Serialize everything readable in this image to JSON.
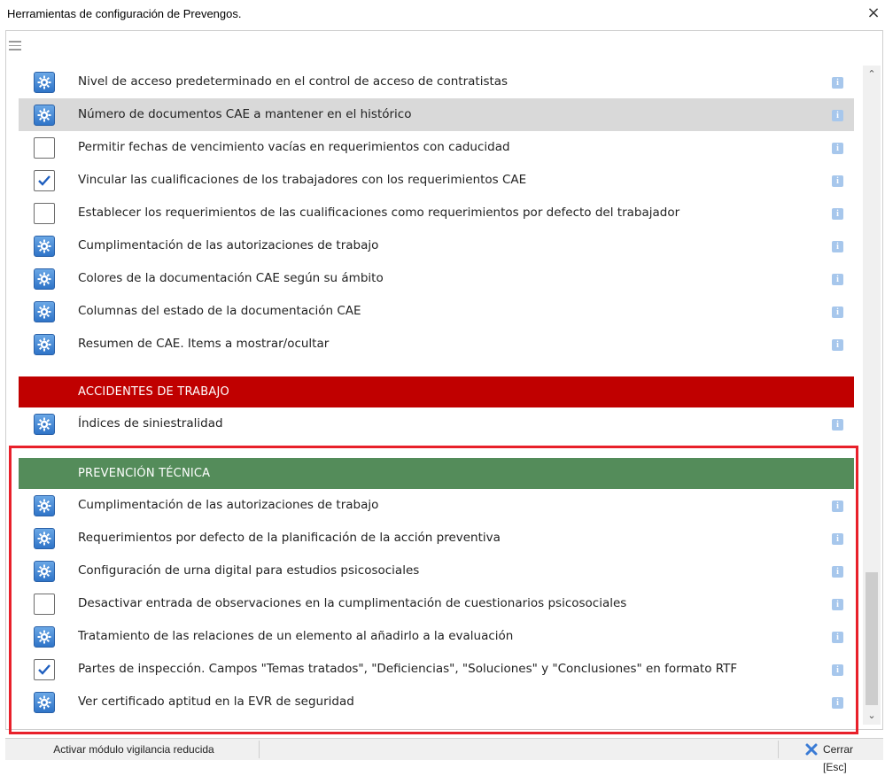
{
  "window": {
    "title": "Herramientas de configuración de Prevengos.",
    "close_glyph": "×"
  },
  "rows_top": [
    {
      "kind": "gear",
      "label": "Nivel de acceso predeterminado en el control de acceso de contratistas",
      "highlight": false
    },
    {
      "kind": "gear",
      "label": "Número de documentos CAE a mantener en el histórico",
      "highlight": true
    },
    {
      "kind": "checkbox",
      "checked": false,
      "label": "Permitir fechas de vencimiento vacías en requerimientos con caducidad",
      "highlight": false
    },
    {
      "kind": "checkbox",
      "checked": true,
      "label": "Vincular las cualificaciones de los trabajadores con los requerimientos CAE",
      "highlight": false
    },
    {
      "kind": "checkbox",
      "checked": false,
      "label": "Establecer los requerimientos de las cualificaciones como requerimientos por defecto del trabajador",
      "highlight": false
    },
    {
      "kind": "gear",
      "label": "Cumplimentación de las autorizaciones de trabajo",
      "highlight": false
    },
    {
      "kind": "gear",
      "label": "Colores de la documentación CAE según su ámbito",
      "highlight": false
    },
    {
      "kind": "gear",
      "label": "Columnas del estado de la documentación CAE",
      "highlight": false
    },
    {
      "kind": "gear",
      "label": "Resumen de CAE. Items a mostrar/ocultar",
      "highlight": false
    }
  ],
  "section_accidentes": {
    "title": "ACCIDENTES DE TRABAJO",
    "color": "#c00000",
    "rows": [
      {
        "kind": "gear",
        "label": "Índices de siniestralidad"
      }
    ]
  },
  "section_prevencion": {
    "title": "PREVENCIÓN TÉCNICA",
    "color": "#548c5a",
    "rows": [
      {
        "kind": "gear",
        "label": "Cumplimentación de las autorizaciones de trabajo"
      },
      {
        "kind": "gear",
        "label": "Requerimientos por defecto de la planificación de la acción preventiva"
      },
      {
        "kind": "gear",
        "label": "Configuración de urna digital para estudios psicosociales"
      },
      {
        "kind": "checkbox",
        "checked": false,
        "label": "Desactivar entrada de observaciones en la cumplimentación de cuestionarios psicosociales"
      },
      {
        "kind": "gear",
        "label": "Tratamiento de las relaciones de un elemento al añadirlo a la evaluación"
      },
      {
        "kind": "checkbox",
        "checked": true,
        "label": "Partes de inspección. Campos \"Temas tratados\", \"Deficiencias\", \"Soluciones\" y \"Conclusiones\" en formato RTF"
      },
      {
        "kind": "gear",
        "label": "Ver certificado aptitud en la EVR de seguridad"
      }
    ]
  },
  "info_glyph": "i",
  "statusbar": {
    "left_button": "Activar módulo vigilancia reducida",
    "close_button": "Cerrar  [Esc]"
  },
  "colors": {
    "highlight_frame": "#e8202a",
    "gear_blue": "#2f74c8",
    "info_blue": "#a7c7ec"
  }
}
